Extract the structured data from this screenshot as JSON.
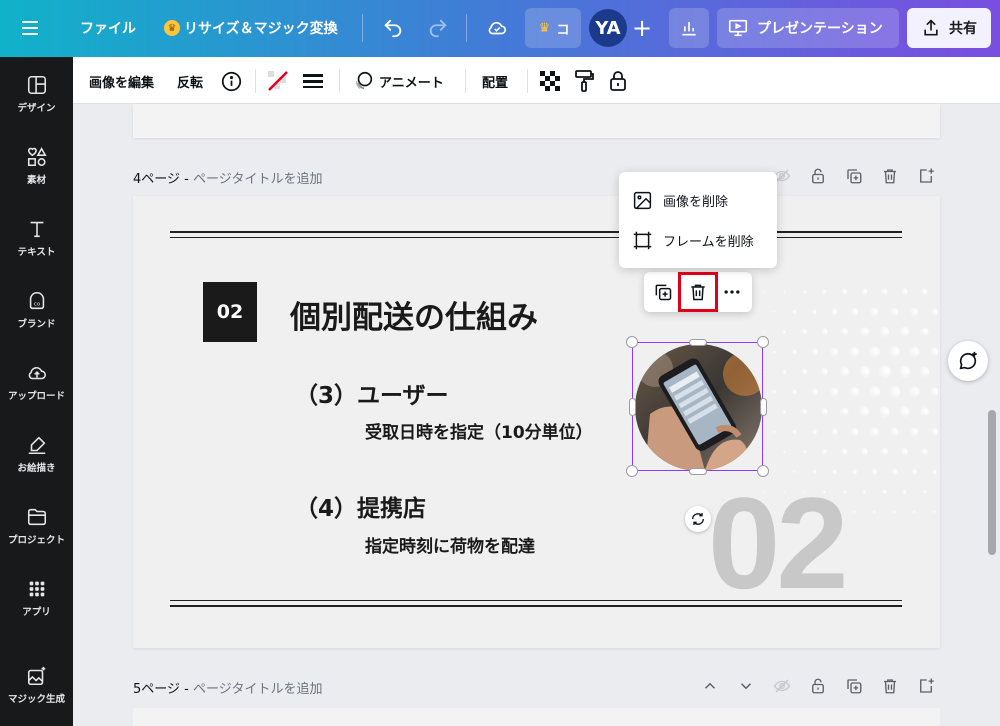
{
  "topbar": {
    "file_label": "ファイル",
    "resize_label": "リサイズ＆マジック変換",
    "pro_label": "コ",
    "avatar_initials": "YA",
    "present_label": "プレゼンテーション",
    "share_label": "共有"
  },
  "sidebar": {
    "items": [
      {
        "label": "デザイン",
        "icon": "layout-icon"
      },
      {
        "label": "素材",
        "icon": "shapes-icon"
      },
      {
        "label": "テキスト",
        "icon": "text-icon"
      },
      {
        "label": "ブランド",
        "icon": "brand-icon"
      },
      {
        "label": "アップロード",
        "icon": "cloud-upload-icon"
      },
      {
        "label": "お絵描き",
        "icon": "draw-icon"
      },
      {
        "label": "プロジェクト",
        "icon": "folder-icon"
      },
      {
        "label": "アプリ",
        "icon": "apps-grid-icon"
      },
      {
        "label": "マジック生成",
        "icon": "magic-image-icon"
      }
    ]
  },
  "toolbar": {
    "edit_image": "画像を編集",
    "flip": "反転",
    "animate": "アニメート",
    "position": "配置"
  },
  "pages": {
    "page4_number": "4ページ - ",
    "page4_title_placeholder": "ページタイトルを追加",
    "page5_number": "5ページ - ",
    "page5_title_placeholder": "ページタイトルを追加"
  },
  "slide": {
    "number_box": "02",
    "title": "個別配送の仕組み",
    "section3_heading": "（3）ユーザー",
    "section3_text": "受取日時を指定（10分単位）",
    "section4_heading": "（4）提携店",
    "section4_text": "指定時刻に荷物を配達",
    "watermark_number": "02"
  },
  "context_menu": {
    "remove_image": "画像を削除",
    "remove_frame": "フレームを削除"
  },
  "colors": {
    "accent": "#8b3dff",
    "highlight": "#e1001b",
    "sidebar_bg": "#18191b"
  }
}
